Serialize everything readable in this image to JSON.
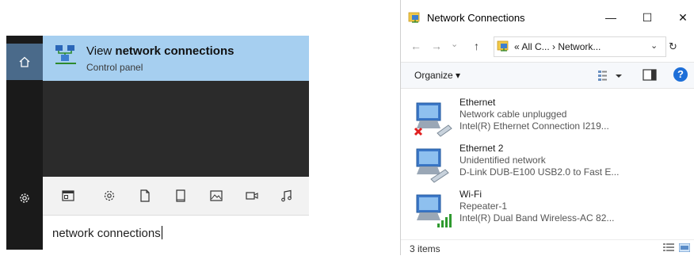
{
  "start": {
    "result": {
      "title_prefix": "View ",
      "title_bold": "network connections",
      "subtitle": "Control panel"
    },
    "search_query": "network connections"
  },
  "window": {
    "title": "Network Connections",
    "controls": {
      "minimize": "—",
      "maximize": "☐",
      "close": "✕"
    },
    "nav": {
      "back": "←",
      "forward": "→",
      "recent": "⌄",
      "up": "↑"
    },
    "address_path": "« All C... › Network...",
    "address_dropdown": "⌄",
    "refresh": "↻",
    "toolbar": {
      "organize": "Organize ▾",
      "help": "?"
    },
    "connections": [
      {
        "name": "Ethernet",
        "status": "Network cable unplugged",
        "device": "Intel(R) Ethernet Connection I219...",
        "state": "disconnected"
      },
      {
        "name": "Ethernet 2",
        "status": "Unidentified network",
        "device": "D-Link DUB-E100 USB2.0 to Fast E...",
        "state": "cable"
      },
      {
        "name": "Wi-Fi",
        "status": "Repeater-1",
        "device": "Intel(R) Dual Band Wireless-AC 82...",
        "state": "wifi"
      }
    ],
    "status_count": "3 items"
  },
  "colors": {
    "accent_highlight": "#a6cff0",
    "panel_dark": "#2b2b2b",
    "rail": "#1a1a1a",
    "help_blue": "#1e6fd8",
    "error_red": "#e02020",
    "signal_green": "#2f9a2f"
  }
}
